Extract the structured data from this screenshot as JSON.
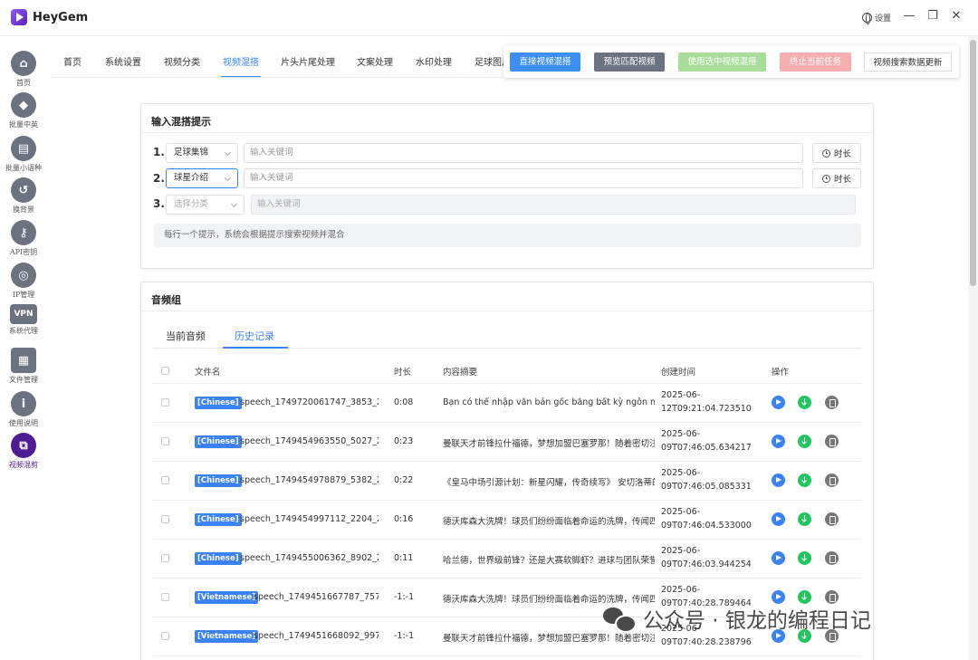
{
  "app": {
    "title": "HeyGem",
    "settings_label": "设置",
    "window_controls": [
      "—",
      "❐",
      "✕"
    ]
  },
  "sidebar": {
    "items": [
      {
        "label": "首页",
        "icon": "home-icon",
        "glyph": "⌂",
        "active": false
      },
      {
        "label": "批量中英",
        "icon": "tag-icon",
        "glyph": "◆",
        "active": false
      },
      {
        "label": "批量小语种",
        "icon": "layers-icon",
        "glyph": "▤",
        "active": false
      },
      {
        "label": "换背景",
        "icon": "undo-icon",
        "glyph": "↺",
        "active": false
      },
      {
        "label": "API密钥",
        "icon": "key-icon",
        "glyph": "⚷",
        "active": false
      },
      {
        "label": "IP管理",
        "icon": "globe-icon",
        "glyph": "◎",
        "active": false
      },
      {
        "label": "系统代理",
        "icon": "vpn-icon",
        "glyph": "VPN",
        "active": false
      },
      {
        "label": "文件管理",
        "icon": "file-icon",
        "glyph": "▦",
        "active": false
      },
      {
        "label": "使用说明",
        "icon": "info-icon",
        "glyph": "i",
        "active": false
      },
      {
        "label": "视频混剪",
        "icon": "crop-icon",
        "glyph": "⧉",
        "active": true
      }
    ]
  },
  "topnav": {
    "tabs": [
      "首页",
      "系统设置",
      "视频分类",
      "视频混搭",
      "片头片尾处理",
      "文案处理",
      "水印处理",
      "足球图片"
    ],
    "active_index": 3
  },
  "actions": {
    "direct_mix": "直接视频混搭",
    "preview_match": "预览匹配视频",
    "use_selected": "使用选中视频混搭",
    "stop_task": "终止当前任务",
    "update_search": "视频搜索数据更新",
    "colors": {
      "direct_mix": "#3b8ff5",
      "preview_match": "#6b7280",
      "use_selected": "#a8dd9a",
      "stop_task": "#f8aeae"
    }
  },
  "prompt_card": {
    "title": "输入混搭提示",
    "rows": [
      {
        "num": "1.",
        "category": "足球集锦",
        "placeholder": "输入关键词",
        "duration_label": "时长",
        "disabled": false,
        "focused": false
      },
      {
        "num": "2.",
        "category": "球星介绍",
        "placeholder": "输入关键词",
        "duration_label": "时长",
        "disabled": false,
        "focused": true
      },
      {
        "num": "3.",
        "category": "选择分类",
        "placeholder": "输入关键词",
        "duration_label": "",
        "disabled": true,
        "focused": false
      }
    ],
    "hint": "每行一个提示，系统会根据提示搜索视频并混合"
  },
  "audio_card": {
    "title": "音频组",
    "tabs": [
      "当前音频",
      "历史记录"
    ],
    "active_tab": 1,
    "columns": [
      "文件名",
      "时长",
      "内容摘要",
      "创建时间",
      "操作"
    ],
    "rows": [
      {
        "lang": "[Chinese]",
        "file": "speech_1749720061747_3853_2…",
        "duration": "0:08",
        "summary": "Bạn có thể nhập văn bản gốc bằng bất kỳ ngôn ngữ nà",
        "created": [
          "2025-06-",
          "12T09:21:04.723510"
        ]
      },
      {
        "lang": "[Chinese]",
        "file": "speech_1749454963550_5027_2…",
        "duration": "0:23",
        "summary": "曼联天才前锋拉什福德，梦想加盟巴塞罗那！随着密切注",
        "created": [
          "2025-06-",
          "09T07:46:05.634217"
        ]
      },
      {
        "lang": "[Chinese]",
        "file": "speech_1749454978879_5382_2…",
        "duration": "0:22",
        "summary": "《皇马中场引源计划：新星闪耀，传奇续写》 安切洛蒂的",
        "created": [
          "2025-06-",
          "09T07:46:05.085331"
        ]
      },
      {
        "lang": "[Chinese]",
        "file": "speech_1749454997112_2204_2…",
        "duration": "0:16",
        "summary": "德沃库森大洗牌！球员们纷纷面临着命运的洗牌，传闻四",
        "created": [
          "2025-06-",
          "09T07:46:04.533000"
        ]
      },
      {
        "lang": "[Chinese]",
        "file": "speech_1749455006362_8902_2…",
        "duration": "0:11",
        "summary": "哈兰德，世界级前锋？还是大赛软脚虾？进球与团队荣誉",
        "created": [
          "2025-06-",
          "09T07:46:03.944254"
        ]
      },
      {
        "lang": "[Vietnamese]",
        "file": "speech_1749451667787_757…",
        "duration": "-1:-1",
        "summary": "德沃库森大洗牌！球员们纷纷面临着命运的洗牌，传闻四",
        "created": [
          "2025-06-",
          "09T07:40:28.789464"
        ]
      },
      {
        "lang": "[Vietnamese]",
        "file": "speech_1749451668092_997…",
        "duration": "-1:-1",
        "summary": "曼联天才前锋拉什福德，梦想加盟巴塞罗那！随着密切注",
        "created": [
          "2025-06-",
          "09T07:40:28.238796"
        ]
      }
    ]
  },
  "watermark": {
    "text": "公众号 · 银龙的编程日记"
  }
}
